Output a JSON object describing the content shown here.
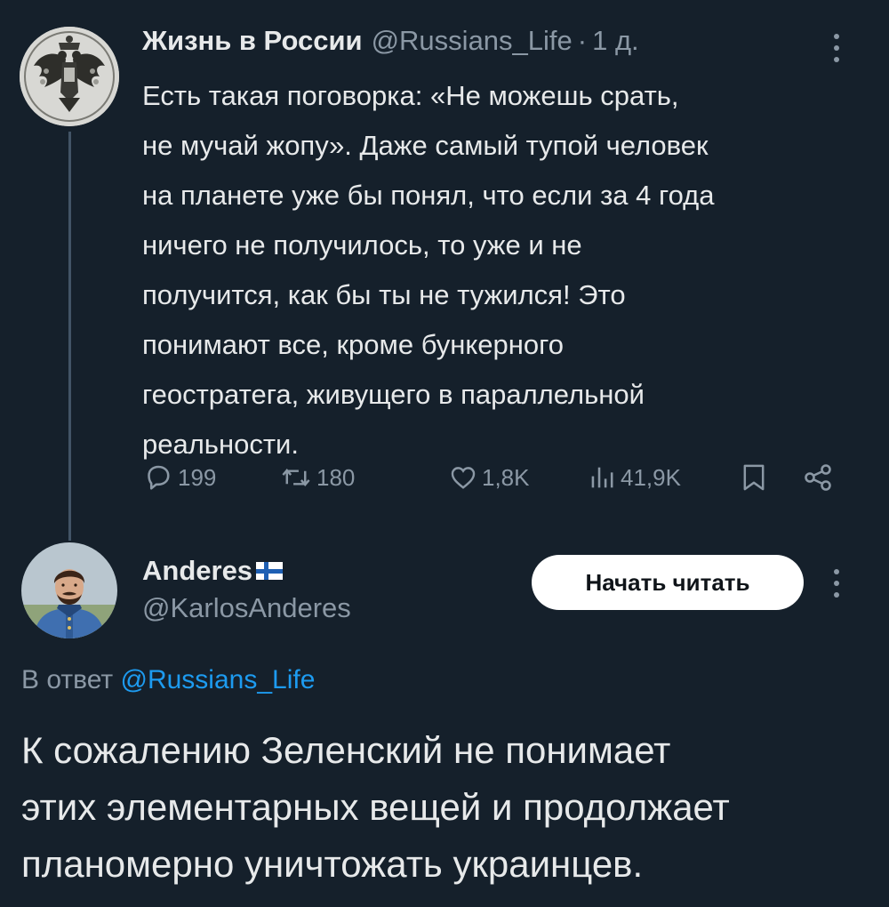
{
  "parent_tweet": {
    "display_name": "Жизнь в России",
    "handle": "@Russians_Life",
    "separator": "·",
    "time": "1 д.",
    "text": "Есть такая поговорка: «Не можешь срать,\nне мучай жопу». Даже самый тупой человек\nна планете уже бы понял, что если за 4 года\nничего не получилось, то уже и не\nполучится, как бы ты не тужился! Это\nпонимают все, кроме бункерного\nгеостратега, живущего в параллельной\nреальности.",
    "avatar_icon": "imperial-eagle-coat-of-arms",
    "actions": {
      "replies": "199",
      "reposts": "180",
      "likes": "1,8K",
      "views": "41,9K",
      "reply_icon": "speech-bubble-icon",
      "repost_icon": "repost-arrows-icon",
      "like_icon": "heart-icon",
      "views_icon": "bar-chart-icon",
      "bookmark_icon": "bookmark-icon",
      "share_icon": "share-icon"
    }
  },
  "reply_tweet": {
    "display_name": "Anderes",
    "name_flag": "finland-flag",
    "handle": "@KarlosAnderes",
    "follow_button": "Начать читать",
    "reply_to_label": "В ответ",
    "reply_to_mention": "@Russians_Life",
    "text": "К сожалению Зеленский не понимает\nэтих элементарных вещей и продолжает\nпланомерно уничтожать украинцев.",
    "avatar_icon": "portrait-man-blue-uniform"
  },
  "colors": {
    "background": "#15202b",
    "text_primary": "#e7e9ea",
    "text_secondary": "#8b98a5",
    "link": "#1d9bf0",
    "button_bg": "#ffffff",
    "button_text": "#0f1419",
    "thread_line": "#425466"
  }
}
